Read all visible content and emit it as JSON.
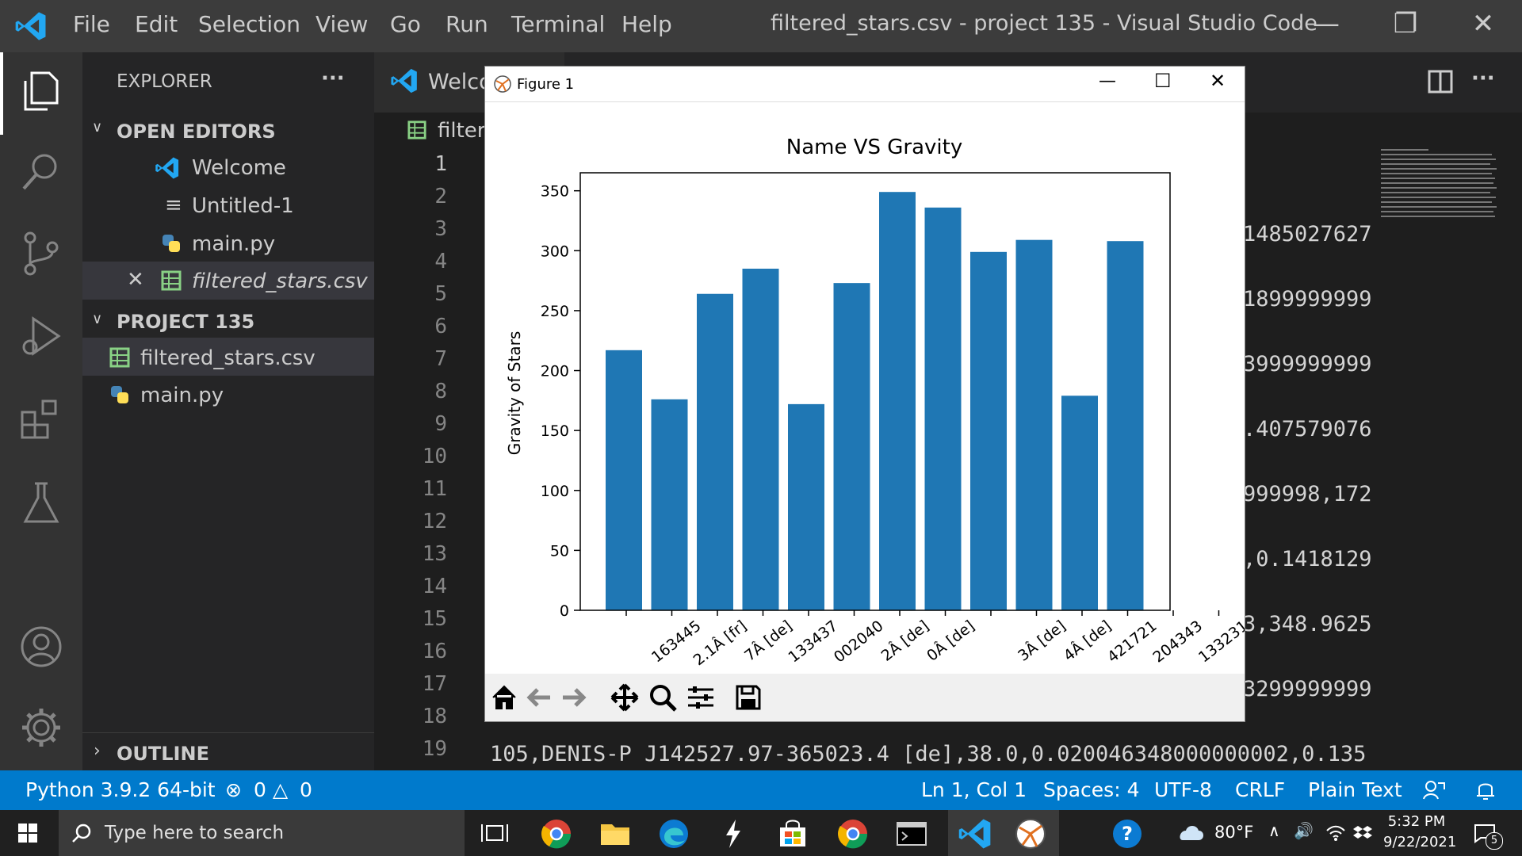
{
  "window": {
    "title": "filtered_stars.csv - project 135 - Visual Studio Code"
  },
  "menu": [
    "File",
    "Edit",
    "Selection",
    "View",
    "Go",
    "Run",
    "Terminal",
    "Help"
  ],
  "sidebar": {
    "header": "EXPLORER",
    "more": "···",
    "open_editors_label": "OPEN EDITORS",
    "open_editors": [
      "Welcome",
      "Untitled-1",
      "main.py",
      "filtered_stars.csv"
    ],
    "project_label": "PROJECT 135",
    "project_files": [
      "filtered_stars.csv",
      "main.py"
    ],
    "outline_label": "OUTLINE"
  },
  "tabs": {
    "welcome": "Welco",
    "file": "filter"
  },
  "editor": {
    "line_numbers": [
      "1",
      "2",
      "3",
      "4",
      "5",
      "6",
      "7",
      "8",
      "9",
      "10",
      "11",
      "12",
      "13",
      "14",
      "15",
      "16",
      "17",
      "18",
      "19"
    ],
    "visible_fragments": [
      {
        "line": 3,
        "text": "1485027627"
      },
      {
        "line": 5,
        "text": "1899999999"
      },
      {
        "line": 7,
        "text": "3999999999"
      },
      {
        "line": 9,
        "text": ".407579076"
      },
      {
        "line": 11,
        "text": "999998,172"
      },
      {
        "line": 13,
        "text": ",0.1418129"
      },
      {
        "line": 15,
        "text": "3,348.9625"
      },
      {
        "line": 17,
        "text": "3299999999"
      }
    ],
    "line19": "105,DENIS-P J142527.97-365023.4 [de],38.0,0.020046348000000002,0.135"
  },
  "statusbar": {
    "python": "Python 3.9.2 64-bit",
    "errors": "0",
    "warnings": "0",
    "position": "Ln 1, Col 1",
    "spaces": "Spaces: 4",
    "encoding": "UTF-8",
    "eol": "CRLF",
    "language": "Plain Text"
  },
  "taskbar": {
    "search_placeholder": "Type here to search",
    "temperature": "80°F",
    "time": "5:32 PM",
    "date": "9/22/2021",
    "notifications": "5"
  },
  "figure": {
    "window_title": "Figure 1"
  },
  "colors": {
    "bar": "#1f77b4",
    "statusbar": "#007acc",
    "accent": "#0e639c"
  },
  "chart_data": {
    "type": "bar",
    "title": "Name VS Gravity",
    "xlabel": "",
    "ylabel": "Gravity of Stars",
    "ylim": [
      0,
      365
    ],
    "yticks": [
      0,
      50,
      100,
      150,
      200,
      250,
      300,
      350
    ],
    "categories": [
      "",
      "163445",
      "2.1Â [fr]",
      "7Â [de]",
      "133437",
      "002040",
      "2Â [de]",
      "0Â [de]",
      "",
      "3Â [de]",
      "4Â [de]",
      "421721",
      "204343",
      "133231"
    ],
    "tick_labels": [
      "163445",
      "2.1Â [fr]",
      "7Â [de]",
      "133437",
      "002040",
      "2Â [de]",
      "0Â [de]",
      "3Â [de]",
      "4Â [de]",
      "421721",
      "204343",
      "133231"
    ],
    "values": [
      217,
      176,
      264,
      285,
      172,
      273,
      349,
      336,
      299,
      309,
      179,
      308
    ]
  }
}
